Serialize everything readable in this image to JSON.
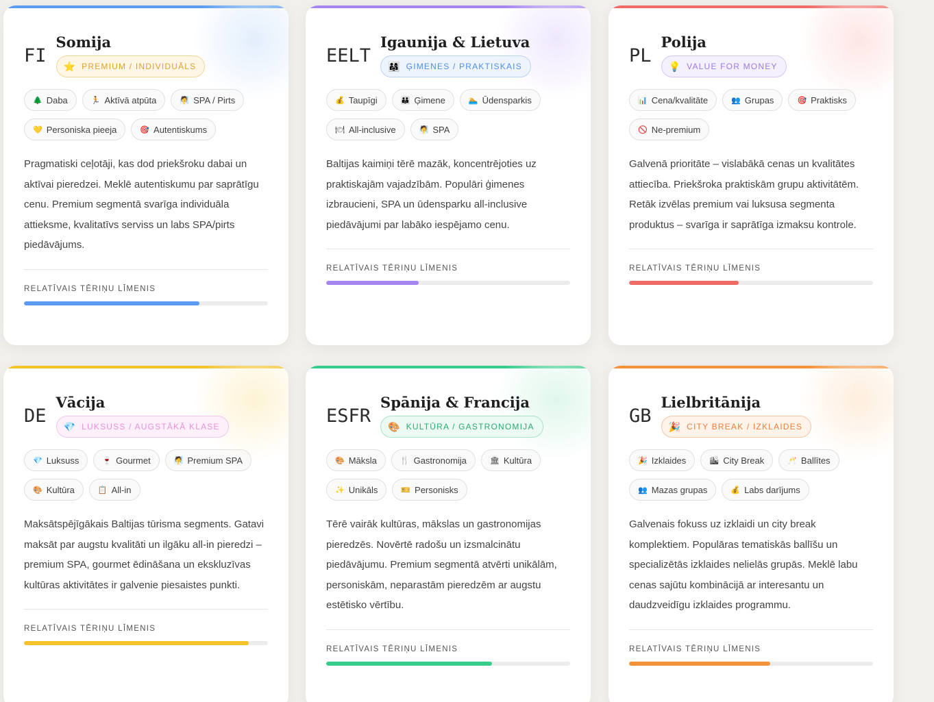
{
  "section_label": "RELATĪVAIS TĒRIŅU LĪMENIS",
  "cards": [
    {
      "code": "FI",
      "title": "Somija",
      "badge_icon": "⭐",
      "badge": "PREMIUM / INDIVIDUĀLS",
      "tags": [
        {
          "icon": "🌲",
          "label": "Daba"
        },
        {
          "icon": "🏃",
          "label": "Aktīvā atpūta"
        },
        {
          "icon": "🧖",
          "label": "SPA / Pirts"
        },
        {
          "icon": "💛",
          "label": "Personiska pieeja"
        },
        {
          "icon": "🎯",
          "label": "Autentiskums"
        }
      ],
      "description": "Pragmatiski ceļotāji, kas dod priekšroku dabai un aktīvai pieredzei. Meklē autentiskumu par saprātīgu cenu. Premium segmentā svarīga individuāla attieksme, kvalitatīvs serviss un labs SPA/pirts piedāvājums.",
      "spending_level": 0.72,
      "colors": {
        "accent": "#5b9cf0",
        "glow": "#e3eefc",
        "badge_bg": "#fff6e6",
        "badge_border": "#f6d59a",
        "badge_text": "#e1a12a"
      }
    },
    {
      "code": "EELT",
      "title": "Igaunija & Lietuva",
      "badge_icon": "👨‍👩‍👧",
      "badge": "ĢIMENES / PRAKTISKAIS",
      "tags": [
        {
          "icon": "💰",
          "label": "Taupīgi"
        },
        {
          "icon": "👪",
          "label": "Ģimene"
        },
        {
          "icon": "🏊",
          "label": "Ūdensparkis"
        },
        {
          "icon": "🍽",
          "label": "All-inclusive"
        },
        {
          "icon": "🧖",
          "label": "SPA"
        }
      ],
      "description": "Baltijas kaimiņi tērē mazāk, koncentrējoties uz praktiskajām vajadzībām. Populāri ģimenes izbraucieni, SPA un ūdensparku all-inclusive piedāvājumi par labāko iespējamo cenu.",
      "spending_level": 0.38,
      "colors": {
        "accent": "#a585f0",
        "glow": "#efe8fd",
        "badge_bg": "#eef4fe",
        "badge_border": "#b9d2f6",
        "badge_text": "#4f8ee6"
      }
    },
    {
      "code": "PL",
      "title": "Polija",
      "badge_icon": "💡",
      "badge": "VALUE FOR MONEY",
      "tags": [
        {
          "icon": "📊",
          "label": "Cena/kvalitāte"
        },
        {
          "icon": "👥",
          "label": "Grupas"
        },
        {
          "icon": "🎯",
          "label": "Praktisks"
        },
        {
          "icon": "🚫",
          "label": "Ne-premium"
        }
      ],
      "description": "Galvenā prioritāte – vislabākā cenas un kvalitātes attiecība. Priekšroka praktiskām grupu aktivitātēm. Retāk izvēlas premium vai luksusa segmenta produktus – svarīga ir saprātīga izmaksu kontrole.",
      "spending_level": 0.45,
      "colors": {
        "accent": "#ef6b66",
        "glow": "#fde6e5",
        "badge_bg": "#f5f0fe",
        "badge_border": "#d6c5f6",
        "badge_text": "#9a7ae6"
      }
    },
    {
      "code": "DE",
      "title": "Vācija",
      "badge_icon": "💎",
      "badge": "LUKSUSS / AUGSTĀKĀ KLASE",
      "tags": [
        {
          "icon": "💎",
          "label": "Luksuss"
        },
        {
          "icon": "🍷",
          "label": "Gourmet"
        },
        {
          "icon": "🧖",
          "label": "Premium SPA"
        },
        {
          "icon": "🎨",
          "label": "Kultūra"
        },
        {
          "icon": "📋",
          "label": "All-in"
        }
      ],
      "description": "Maksātspējīgākais Baltijas tūrisma segments. Gatavi maksāt par augstu kvalitāti un ilgāku all-in pieredzi – premium SPA, gourmet ēdināšana un ekskluzīvas kultūras aktivitātes ir galvenie piesaistes punkti.",
      "spending_level": 0.92,
      "colors": {
        "accent": "#f4c22b",
        "glow": "#fdf3d5",
        "badge_bg": "#fdf0fb",
        "badge_border": "#f3c6ec",
        "badge_text": "#e88fdb"
      }
    },
    {
      "code": "ESFR",
      "title": "Spānija & Francija",
      "badge_icon": "🎨",
      "badge": "KULTŪRA / GASTRONOMIJA",
      "tags": [
        {
          "icon": "🎨",
          "label": "Māksla"
        },
        {
          "icon": "🍴",
          "label": "Gastronomija"
        },
        {
          "icon": "🏛",
          "label": "Kultūra"
        },
        {
          "icon": "✨",
          "label": "Unikāls"
        },
        {
          "icon": "🎫",
          "label": "Personisks"
        }
      ],
      "description": "Tērē vairāk kultūras, mākslas un gastronomijas pieredzēs. Novērtē radošu un izsmalcinātu piedāvājumu. Premium segmentā atvērti unikālām, personiskām, neparastām pieredzēm ar augstu estētisko vērtību.",
      "spending_level": 0.68,
      "colors": {
        "accent": "#35cc8c",
        "glow": "#e0f7ec",
        "badge_bg": "#ebfaf2",
        "badge_border": "#a7e3c5",
        "badge_text": "#2caa72"
      }
    },
    {
      "code": "GB",
      "title": "Lielbritānija",
      "badge_icon": "🎉",
      "badge": "CITY BREAK / IZKLAIDES",
      "tags": [
        {
          "icon": "🎉",
          "label": "Izklaides"
        },
        {
          "icon": "🏙",
          "label": "City Break"
        },
        {
          "icon": "🥂",
          "label": "Ballītes"
        },
        {
          "icon": "👥",
          "label": "Mazas grupas"
        },
        {
          "icon": "💰",
          "label": "Labs darījums"
        }
      ],
      "description": "Galvenais fokuss uz izklaidi un city break komplektiem. Populāras tematiskās ballīšu un specializētās izklaides nelielās grupās. Meklē labu cenas sajūtu kombinācijā ar interesantu un daudzveidīgu izklaides programmu.",
      "spending_level": 0.58,
      "colors": {
        "accent": "#f3923a",
        "glow": "#fdeedd",
        "badge_bg": "#fff3ea",
        "badge_border": "#f6c7a2",
        "badge_text": "#ef7e3c"
      }
    }
  ]
}
